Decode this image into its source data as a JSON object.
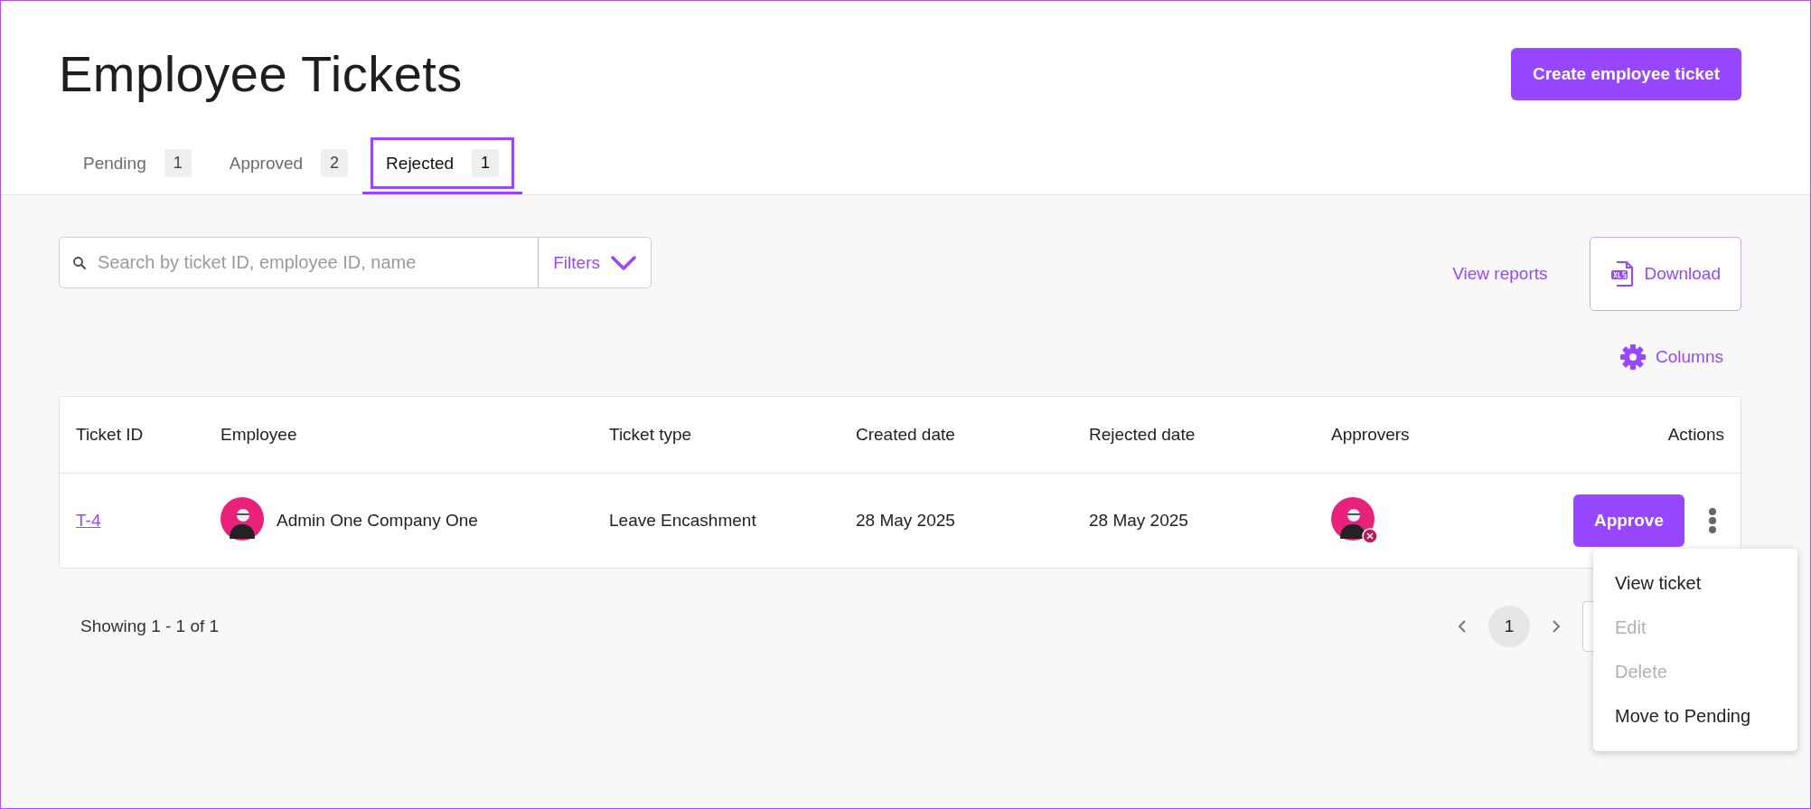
{
  "page": {
    "title": "Employee Tickets",
    "create_button": "Create employee ticket"
  },
  "tabs": [
    {
      "label": "Pending",
      "count": "1",
      "selected": false
    },
    {
      "label": "Approved",
      "count": "2",
      "selected": false
    },
    {
      "label": "Rejected",
      "count": "1",
      "selected": true
    }
  ],
  "toolbar": {
    "search_placeholder": "Search by ticket ID, employee ID, name",
    "filters": "Filters",
    "view_reports": "View reports",
    "download": "Download",
    "columns": "Columns"
  },
  "table": {
    "columns": [
      "Ticket ID",
      "Employee",
      "Ticket type",
      "Created date",
      "Rejected date",
      "Approvers",
      "Actions"
    ],
    "rows": [
      {
        "ticket_id": "T-4",
        "employee": "Admin One Company One",
        "ticket_type": "Leave Encashment",
        "created_date": "28 May 2025",
        "rejected_date": "28 May 2025",
        "approvers": [
          {
            "rejected": true
          }
        ],
        "action": "Approve"
      }
    ]
  },
  "pagination": {
    "summary": "Showing 1 - 1 of 1",
    "pages": [
      {
        "label": "1",
        "selected": true
      }
    ]
  },
  "menu": {
    "items": [
      {
        "label": "View ticket",
        "disabled": false
      },
      {
        "label": "Edit",
        "disabled": true
      },
      {
        "label": "Delete",
        "disabled": true
      },
      {
        "label": "Move to Pending",
        "disabled": false
      }
    ]
  }
}
